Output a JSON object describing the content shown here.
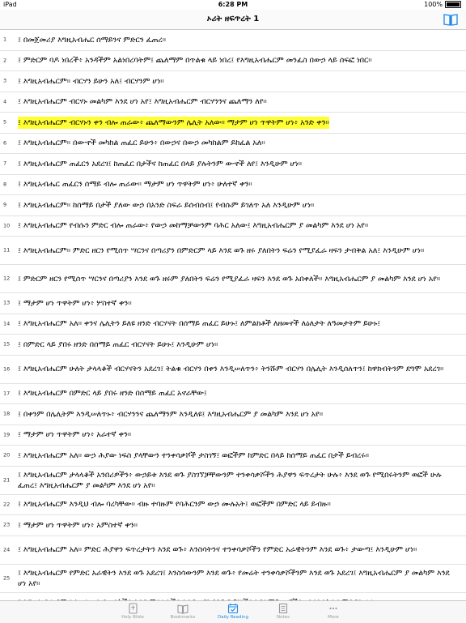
{
  "status_bar": {
    "left": "iPad",
    "time": "6:28 PM",
    "battery": "100%"
  },
  "nav": {
    "title": "ኦሪት ዘፍጥረት 1"
  },
  "verses": [
    {
      "num": "1",
      "text": "፤ በመጀመሪያ እግዚአብሔር ሰማይንና ምድርን ፈጠረ።",
      "lines": 1
    },
    {
      "num": "2",
      "text": "፤ ምድርም ባዶ ነበረች፥ አንዳችም አልነበረባትም፤ ጨለማም በጥልቁ ላይ ነበረ፤ የእግዚአብሔርም መንፈስ በውኃ ላይ ሰፍፎ ነበር።",
      "lines": 1
    },
    {
      "num": "3",
      "text": "፤ እግዚአብሔርም። ብርሃን ይሁን አለ፤ ብርሃንም ሆነ።",
      "lines": 1
    },
    {
      "num": "4",
      "text": "፤ እግዚአብሔርም ብርሃኑ መልካም እንደ ሆነ አየ፤ እግዚአብሔርም ብርሃንንና ጨለማን ለየ።",
      "lines": 1
    },
    {
      "num": "5",
      "text": "፤ እግዚአብሔርም ብርሃኑን ቀን ብሎ ጠራው፥ ጨለማውንም ሌሊት አለው። ማታም ሆነ ጥዋትም ሆነ፥ አንድ ቀን።",
      "lines": 1,
      "highlight": true
    },
    {
      "num": "6",
      "text": "፤ እግዚአብሔርም። በውኆች መካከል ጠፈር ይሁን፥ በውኃና በውኃ መካከልም ይከፈል አለ።",
      "lines": 1
    },
    {
      "num": "7",
      "text": "፤ እግዚአብሔርም ጠፈርን አደረገ፤ ከጠፈር በታችና ከጠፈር በላይ ያሉትንም ውኆች ለየ፤ እንዲሁም ሆነ።",
      "lines": 1
    },
    {
      "num": "8",
      "text": "፤ እግዚአብሔር ጠፈርን ሰማይ ብሎ ጠራው። ማታም ሆነ ጥዋትም ሆነ፥ ሁለተኛ ቀን።",
      "lines": 1
    },
    {
      "num": "9",
      "text": "፤ እግዚአብሔርም። ከሰማይ በታች ያለው ውኃ በአንድ ስፍራ ይሰብሰብ፤ የብሱም ይገለጥ አለ እንዲሁም ሆነ።",
      "lines": 1
    },
    {
      "num": "10",
      "text": "፤ እግዚአብሔርም የብሱን ምድር ብሎ ጠራው፥ የውኃ መከማቻውንም ባሕር አለው፤ እግዚአብሔርም ያ መልካም እንደ ሆነ አየ።",
      "lines": 1
    },
    {
      "num": "11",
      "text": "፤ እግዚአብሔርም። ምድር ዘርን የሚሰጥ ሣርንና በጣሪያን በምድርም ላይ እንደ ወጉ ዘሩ ያለበትን ፍሬን የሚያፈራ ዛፍን ታብቅል አለ፤ እንዲሁም ሆነ።",
      "lines": 2
    },
    {
      "num": "12",
      "text": "፤ ምድርም ዘርን የሚሰጥ ሣርንና በጣሪያን እንደ ወጉ ዘሩም ያለበትን ፍሬን የሚያፈራ ዛፍን እንደ ወጉ አበቀለች። እግዚአብሔርም ያ መልካም እንደ ሆነ አየ።",
      "lines": 2
    },
    {
      "num": "13",
      "text": "፤ ማታም ሆነ ጥዋትም ሆነ፥ ሦስተኛ ቀን።",
      "lines": 1
    },
    {
      "num": "14",
      "text": "፤ እግዚአብሔርም አለ። ቀንና ሌሊትን ይለዩ ዘንድ ብርሃናት በሰማይ ጠፈር ይሁኑ፤ ለምልክቶች ለዘመኖች ለዕለታት ለዓመታትም ይሁኑ፤",
      "lines": 1
    },
    {
      "num": "15",
      "text": "፤ በምድር ላይ ያበሩ ዘንድ በሰማይ ጠፈር ብርሃናት ይሁኑ፤ እንዲሁም ሆነ።",
      "lines": 1
    },
    {
      "num": "16",
      "text": "፤ እግዚአብሔርም ሁለት ታላላቆች ብርሃናትን አደረገ፤ ትልቁ ብርሃን በቀን እንዲሠለጥን፥ ትንሹም ብርሃን በሌሊት እንዲሰለጥን፤ ከዋክብትንም ደግሞ አደረገ።",
      "lines": 2
    },
    {
      "num": "17",
      "text": "፤ እግዚአብሔርም በምድር ላይ ያበሩ ዘንድ በሰማይ ጠፈር አኖራቸው፤",
      "lines": 1
    },
    {
      "num": "18",
      "text": "፤ በቀንም በሌሊትም እንዲሠለጥኑ፥ ብርሃንንና ጨለማንም እንዲለዩ፤ እግዚአብሔርም ያ መልካም እንደ ሆነ አየ።",
      "lines": 1
    },
    {
      "num": "19",
      "text": "፤ ማታም ሆነ ጥዋትም ሆነ፥ አራተኛ ቀን።",
      "lines": 1
    },
    {
      "num": "20",
      "text": "፤ እግዚአብሔርም አለ። ውኃ ሕያው ነፍስ ያላቸውን ተንቀሳቃሾች ታስገኝ፤ ወፎችም ከምድር በላይ ከሰማይ ጠፈር በታች ይብረሩ።",
      "lines": 1
    },
    {
      "num": "21",
      "text": "፤ እግዚአብሔርም ታላላቆች አንበሪዎችን፥ ውኃይቱ እንደ ወጉ ያስገኘቻቸውንም ተንቀሳቃሾችን ሕያዋን ፍጥረታት ሁሉ፥ እንደ ወጉ የሚበሩትንም ወፎች ሁሉ ፈጠረ፤ እግዚአብሔርም ያ መልካም እንደ ሆነ አየ።",
      "lines": 2
    },
    {
      "num": "22",
      "text": "፤ እግዚአብሔርም እንዲህ ብሎ ባረካቸው። ብዙ ተባዙም የባሕርንም ውኃ ሙሉአት፤ ወፎችም በምድር ላይ ይብዙ።",
      "lines": 1
    },
    {
      "num": "23",
      "text": "፤ ማታም ሆነ ጥዋትም ሆነ፥ አምስተኛ ቀን።",
      "lines": 1
    },
    {
      "num": "24",
      "text": "፤ እግዚአብሔርም አለ። ምድር ሕያዋን ፍጥረታትን እንደ ወጉ፥ እንስሳትንና ተንቀሳቃሾችን የምድር አራዊትንም እንደ ወጉ፥ ታውጣ፤ እንዲሁም ሆነ።",
      "lines": 2
    },
    {
      "num": "25",
      "text": "፤ እግዚአብሔርም የምድር አራዊትን እንደ ወጉ አደረገ፤ እንስሳውንም እንደ ወጉ፥ የመሬት ተንቀሳቃሾችንም እንደ ወጉ አደረገ፤ እግዚአብሔርም ያ መልካም እንደ ሆነ አየ።",
      "lines": 2
    },
    {
      "num": "26",
      "text": "፤ እግዚአብሔርም አለ። ሰውን በመልካችን እንደ ምሳሌአችን እንፍጠር፤ የባሕር ዓሦችንና የሰማይ ወፎችን፥ እንስሳትንና ምድርን ሁሉ",
      "lines": 1
    }
  ],
  "tabs": [
    {
      "key": "holy-bible",
      "label": "Holy Bible",
      "icon": "bible-icon",
      "active": false
    },
    {
      "key": "bookmarks",
      "label": "Bookmarks",
      "icon": "bookmarks-icon",
      "active": false
    },
    {
      "key": "daily-reading",
      "label": "Daily Reading",
      "icon": "calendar-check-icon",
      "active": true
    },
    {
      "key": "notes",
      "label": "Notes",
      "icon": "notes-icon",
      "active": false
    },
    {
      "key": "more",
      "label": "More",
      "icon": "more-dots-icon",
      "active": false
    }
  ],
  "colors": {
    "accent": "#1e88e5",
    "highlight": "#ffff33",
    "tab_inactive": "#999999"
  }
}
